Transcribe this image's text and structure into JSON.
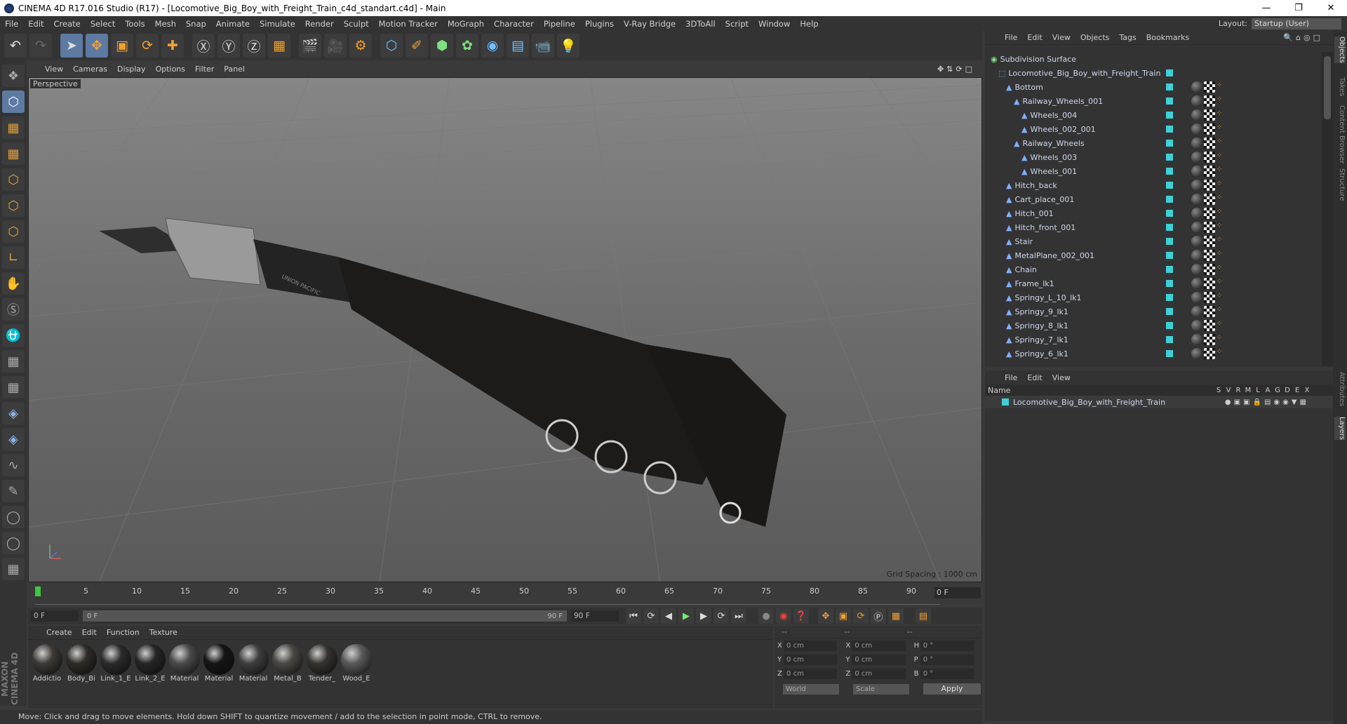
{
  "window": {
    "title": "CINEMA 4D R17.016 Studio (R17) - [Locomotive_Big_Boy_with_Freight_Train_c4d_standart.c4d] - Main"
  },
  "menubar": {
    "items": [
      "File",
      "Edit",
      "Create",
      "Select",
      "Tools",
      "Mesh",
      "Snap",
      "Animate",
      "Simulate",
      "Render",
      "Sculpt",
      "Motion Tracker",
      "MoGraph",
      "Character",
      "Pipeline",
      "Plugins",
      "V-Ray Bridge",
      "3DToAll",
      "Script",
      "Window",
      "Help"
    ],
    "layout_label": "Layout:",
    "layout_value": "Startup (User)"
  },
  "viewport": {
    "menu": [
      "View",
      "Cameras",
      "Display",
      "Options",
      "Filter",
      "Panel"
    ],
    "camera_label": "Perspective",
    "grid_spacing": "Grid Spacing : 1000 cm",
    "decal_text": "UNION PACIFIC"
  },
  "timeline": {
    "ticks": [
      "0",
      "5",
      "10",
      "15",
      "20",
      "25",
      "30",
      "35",
      "40",
      "45",
      "50",
      "55",
      "60",
      "65",
      "70",
      "75",
      "80",
      "85",
      "90"
    ],
    "current_frame": "0 F",
    "start_field": "0 F",
    "range_start": "0 F",
    "range_end": "90 F",
    "end_field": "90 F"
  },
  "material_panel": {
    "menu": [
      "Create",
      "Edit",
      "Function",
      "Texture"
    ],
    "materials": [
      {
        "name": "Addictio",
        "color": "#3d3a36"
      },
      {
        "name": "Body_Bi",
        "color": "#2f2c28"
      },
      {
        "name": "Link_1_E",
        "color": "#2b2b2b"
      },
      {
        "name": "Link_2_E",
        "color": "#262626"
      },
      {
        "name": "Material",
        "color": "#4a4a4a"
      },
      {
        "name": "Material",
        "color": "#151515"
      },
      {
        "name": "Material",
        "color": "#3e3e3e"
      },
      {
        "name": "Metal_B",
        "color": "#4a4844"
      },
      {
        "name": "Tender_",
        "color": "#36332f"
      },
      {
        "name": "Wood_E",
        "color": "#5a5a5a"
      }
    ]
  },
  "coordinates": {
    "header": [
      "--",
      "--",
      "--"
    ],
    "rows": [
      {
        "a": "X",
        "av": "0 cm",
        "b": "X",
        "bv": "0 cm",
        "c": "H",
        "cv": "0 °"
      },
      {
        "a": "Y",
        "av": "0 cm",
        "b": "Y",
        "bv": "0 cm",
        "c": "P",
        "cv": "0 °"
      },
      {
        "a": "Z",
        "av": "0 cm",
        "b": "Z",
        "bv": "0 cm",
        "c": "B",
        "cv": "0 °"
      }
    ],
    "mode": "World",
    "scale": "Scale",
    "apply": "Apply"
  },
  "status": "Move: Click and drag to move elements. Hold down SHIFT to quantize movement / add to the selection in point mode, CTRL to remove.",
  "brand": "MAXON CINEMA 4D",
  "object_manager": {
    "menu": [
      "File",
      "Edit",
      "View",
      "Objects",
      "Tags",
      "Bookmarks"
    ],
    "objects": [
      {
        "name": "Subdivision Surface",
        "indent": 0,
        "icon": "subdivision-icon"
      },
      {
        "name": "Locomotive_Big_Boy_with_Freight_Train",
        "indent": 1,
        "icon": "null-icon"
      },
      {
        "name": "Bottom",
        "indent": 2,
        "icon": "polygon-icon"
      },
      {
        "name": "Railway_Wheels_001",
        "indent": 3,
        "icon": "polygon-icon"
      },
      {
        "name": "Wheels_004",
        "indent": 4,
        "icon": "polygon-icon"
      },
      {
        "name": "Wheels_002_001",
        "indent": 4,
        "icon": "polygon-icon"
      },
      {
        "name": "Railway_Wheels",
        "indent": 3,
        "icon": "polygon-icon"
      },
      {
        "name": "Wheels_003",
        "indent": 4,
        "icon": "polygon-icon"
      },
      {
        "name": "Wheels_001",
        "indent": 4,
        "icon": "polygon-icon"
      },
      {
        "name": "Hitch_back",
        "indent": 2,
        "icon": "polygon-icon"
      },
      {
        "name": "Cart_place_001",
        "indent": 2,
        "icon": "polygon-icon"
      },
      {
        "name": "Hitch_001",
        "indent": 2,
        "icon": "polygon-icon"
      },
      {
        "name": "Hitch_front_001",
        "indent": 2,
        "icon": "polygon-icon"
      },
      {
        "name": "Stair",
        "indent": 2,
        "icon": "polygon-icon"
      },
      {
        "name": "MetalPlane_002_001",
        "indent": 2,
        "icon": "polygon-icon"
      },
      {
        "name": "Chain",
        "indent": 2,
        "icon": "polygon-icon"
      },
      {
        "name": "Frame_lk1",
        "indent": 2,
        "icon": "polygon-icon"
      },
      {
        "name": "Springy_L_10_lk1",
        "indent": 2,
        "icon": "polygon-icon"
      },
      {
        "name": "Springy_9_lk1",
        "indent": 2,
        "icon": "polygon-icon"
      },
      {
        "name": "Springy_8_lk1",
        "indent": 2,
        "icon": "polygon-icon"
      },
      {
        "name": "Springy_7_lk1",
        "indent": 2,
        "icon": "polygon-icon"
      },
      {
        "name": "Springy_6_lk1",
        "indent": 2,
        "icon": "polygon-icon"
      }
    ]
  },
  "side_tabs": [
    "Objects",
    "Takes",
    "Content Browser",
    "Structure",
    "Attributes",
    "Layers"
  ],
  "layer_manager": {
    "menu": [
      "File",
      "Edit",
      "View"
    ],
    "name_col": "Name",
    "cols": [
      "S",
      "V",
      "R",
      "M",
      "L",
      "A",
      "G",
      "D",
      "E",
      "X"
    ],
    "layers": [
      {
        "name": "Locomotive_Big_Boy_with_Freight_Train"
      }
    ]
  }
}
